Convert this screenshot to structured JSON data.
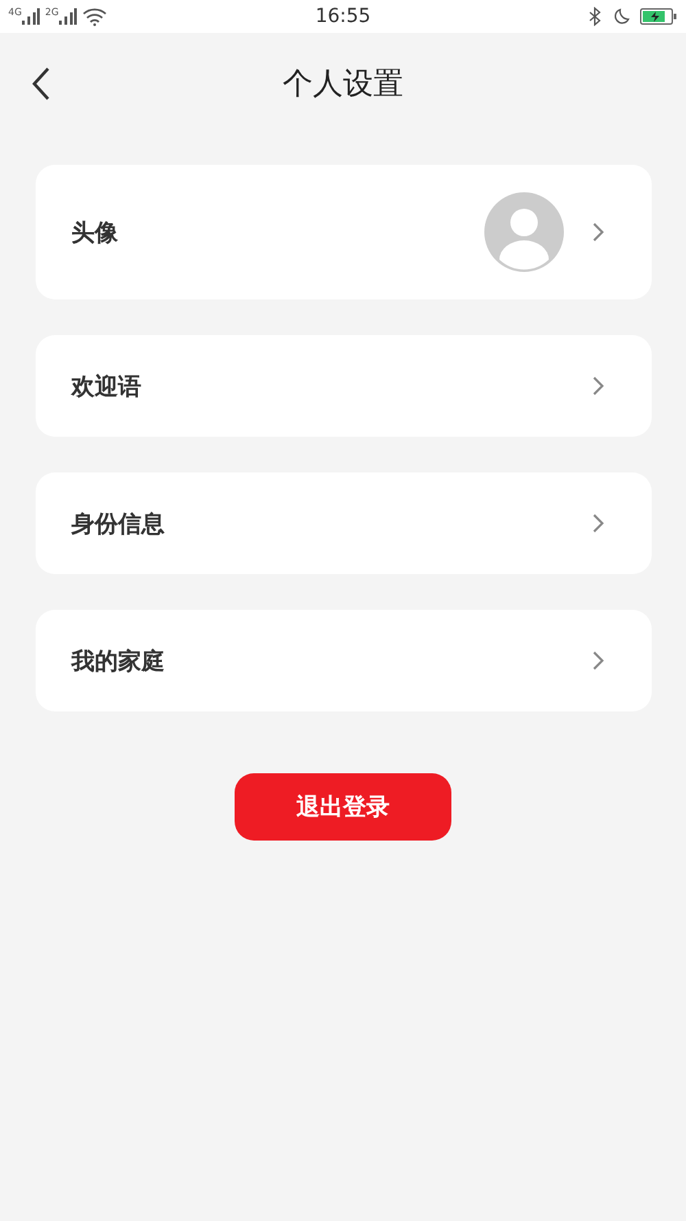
{
  "status_bar": {
    "networks": [
      "4G",
      "2G"
    ],
    "time": "16:55",
    "battery_charging": true
  },
  "header": {
    "title": "个人设置"
  },
  "items": [
    {
      "kind": "avatar",
      "label": "头像"
    },
    {
      "kind": "plain",
      "label": "欢迎语"
    },
    {
      "kind": "plain",
      "label": "身份信息"
    },
    {
      "kind": "plain",
      "label": "我的家庭"
    }
  ],
  "logout_button": {
    "label": "退出登录"
  }
}
